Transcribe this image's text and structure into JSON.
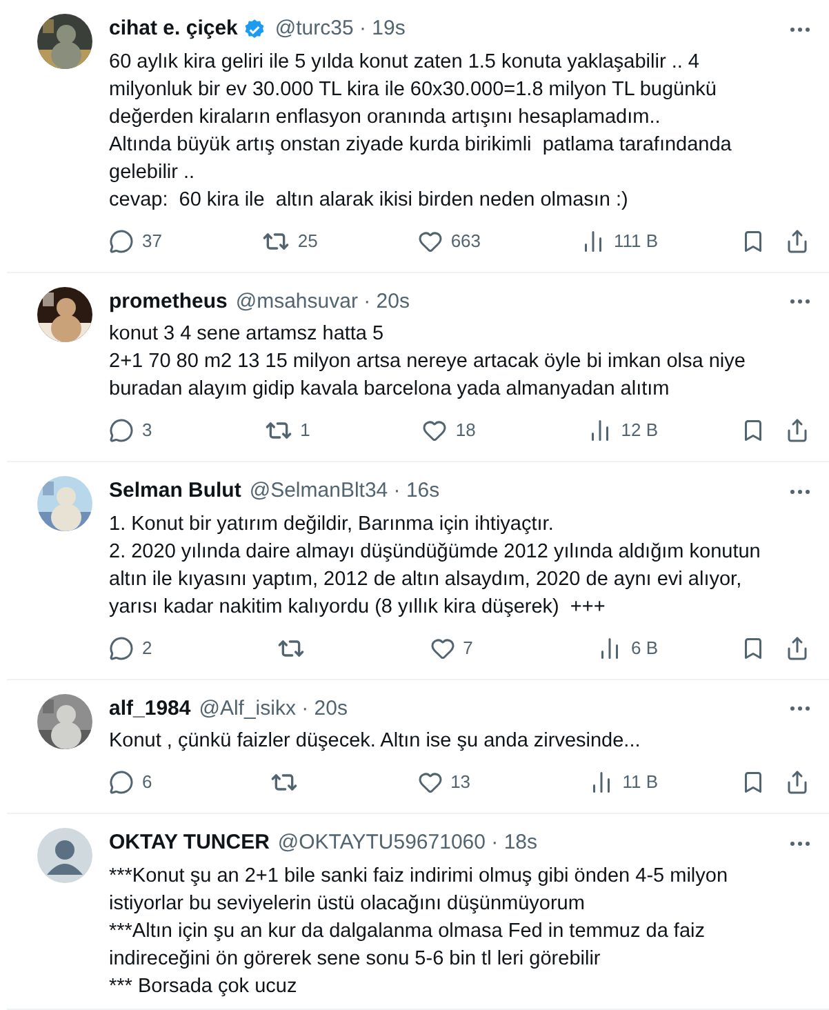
{
  "tweets": [
    {
      "name": "cihat e. çiçek",
      "verified": true,
      "handle": "@turc35 · 19s",
      "text": "60 aylık kira geliri ile 5 yılda konut zaten 1.5 konuta yaklaşabilir .. 4 milyonluk bir ev 30.000 TL kira ile 60x30.000=1.8 milyon TL bugünkü değerden kiraların enflasyon oranında artışını hesaplamadım..\nAltında büyük artış onstan ziyade kurda birikimli  patlama tarafındanda gelebilir ..\ncevap:  60 kira ile  altın alarak ikisi birden neden olmasın :)",
      "actions": {
        "replies": "37",
        "reposts": "25",
        "likes": "663",
        "views": "111 B"
      }
    },
    {
      "name": "prometheus",
      "verified": false,
      "handle": "@msahsuvar · 20s",
      "text": "konut 3 4 sene artamsz hatta 5\n2+1 70 80 m2 13 15 milyon artsa nereye artacak öyle bi imkan olsa niye buradan alayım gidip kavala barcelona yada almanyadan alıtım",
      "actions": {
        "replies": "3",
        "reposts": "1",
        "likes": "18",
        "views": "12 B"
      }
    },
    {
      "name": "Selman Bulut",
      "verified": false,
      "handle": "@SelmanBlt34 · 16s",
      "text": "1. Konut bir yatırım değildir, Barınma için ihtiyaçtır.\n2. 2020 yılında daire almayı düşündüğümde 2012 yılında aldığım konutun altın ile kıyasını yaptım, 2012 de altın alsaydım, 2020 de aynı evi alıyor, yarısı kadar nakitim kalıyordu (8 yıllık kira düşerek)  +++",
      "actions": {
        "replies": "2",
        "likes": "7",
        "views": "6 B"
      }
    },
    {
      "name": "alf_1984",
      "verified": false,
      "handle": "@Alf_isikx · 20s",
      "text": "Konut , çünkü faizler düşecek. Altın ise şu anda zirvesinde...",
      "actions": {
        "replies": "6",
        "likes": "13",
        "views": "11 B"
      }
    },
    {
      "name": "OKTAY TUNCER",
      "verified": false,
      "handle": "@OKTAYTU59671060 · 18s",
      "avatar": {
        "kind": "default"
      },
      "text": "***Konut şu an 2+1 bile sanki faiz indirimi olmuş gibi önden 4-5 milyon istiyorlar bu seviyelerin üstü olacağını düşünmüyorum\n***Altın için şu an kur da dalgalanma olmasa Fed in temmuz da faiz indireceğini ön görerek sene sonu 5-6 bin tl leri görebilir\n*** Borsada çok ucuz"
    }
  ]
}
